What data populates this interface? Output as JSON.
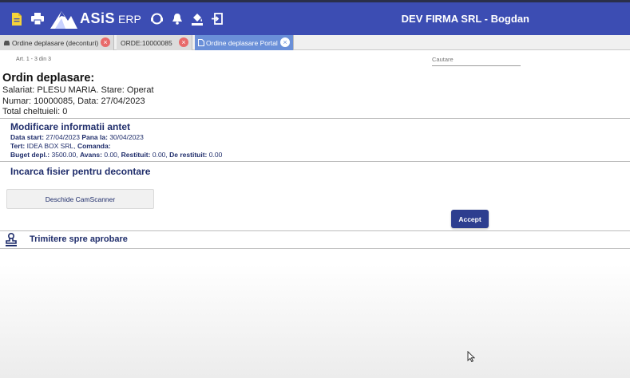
{
  "header": {
    "logo_text": "ASiS",
    "logo_erp": "ERP",
    "company": "DEV FIRMA SRL - Bogdan",
    "icons": [
      "document-icon",
      "print-icon",
      "support-icon",
      "bell-icon",
      "paint-bucket-icon",
      "logout-icon"
    ]
  },
  "tabs": [
    {
      "label": "Ordine deplasare (deconturi)",
      "icon": "car-icon"
    },
    {
      "label": "ORDE:10000085",
      "icon": ""
    },
    {
      "label": "Ordine deplasare Portal",
      "icon": "file-icon"
    }
  ],
  "list": {
    "art_count": "Art. 1 - 3 din 3",
    "search_placeholder": "Cautare"
  },
  "doc": {
    "title": "Ordin deplasare:",
    "salariat": "Salariat: PLESU MARIA. Stare: Operat",
    "numar": "Numar: 10000085, Data: 27/04/2023",
    "total": "Total cheltuieli: 0"
  },
  "header_section": {
    "title": "Modificare informatii antet",
    "data_start_label": "Data start:",
    "data_start": "27/04/2023",
    "pana_la_label": "Pana la:",
    "pana_la": "30/04/2023",
    "tert_label": "Tert:",
    "tert": "IDEA BOX SRL,",
    "comanda_label": "Comanda:",
    "buget_label": "Buget depl.:",
    "buget": "3500.00,",
    "avans_label": "Avans:",
    "avans": "0.00,",
    "restituit_label": "Restituit:",
    "restituit": "0.00,",
    "de_restituit_label": "De restituit:",
    "de_restituit": "0.00"
  },
  "upload_section": {
    "title": "Incarca fisier pentru decontare",
    "scanner_button": "Deschide CamScanner",
    "accept_button": "Accept"
  },
  "approval": {
    "label": "Trimitere spre aprobare",
    "icon": "stamp-icon"
  },
  "colors": {
    "topbar": "#3c4db3",
    "active_tab": "#6a8fd8",
    "accent_text": "#1f2d6b",
    "accept": "#2d3e8f",
    "tab_close": "#e86a6a"
  }
}
